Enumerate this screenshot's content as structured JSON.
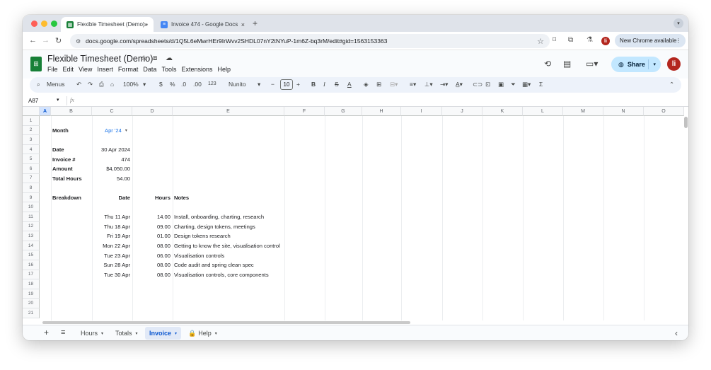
{
  "browser": {
    "tabs": [
      {
        "title": "Flexible Timesheet (Demo) - ",
        "close": "×"
      },
      {
        "title": "Invoice 474 - Google Docs",
        "close": "×"
      }
    ],
    "new_tab": "+",
    "url": "docs.google.com/spreadsheets/d/1Q5L6eMwrHEr9IrWvv2SHDL07nY2tNYuP-1m6Z-bq3rM/edit#gid=1563153363",
    "profile_initial": "li",
    "update_pill": "New Chrome available",
    "update_pill_more": "⋮"
  },
  "docs": {
    "title": "Flexible Timesheet (Demo)",
    "menu": [
      "File",
      "Edit",
      "View",
      "Insert",
      "Format",
      "Data",
      "Tools",
      "Extensions",
      "Help"
    ],
    "share_label": "Share",
    "avatar_initial": "li"
  },
  "toolbar": {
    "search": "Menus",
    "zoom": "100%",
    "currency": "$",
    "percent": "%",
    "dec_less": ".0",
    "dec_more": ".00",
    "num_format": "123",
    "font": "Nunito",
    "font_size": "10",
    "minus": "−",
    "plus": "+",
    "bold": "B",
    "italic": "I",
    "strike": "S",
    "text_color": "A",
    "sigma": "Σ"
  },
  "formula_bar": {
    "cell_ref": "A87",
    "fx": "fx",
    "value": ""
  },
  "columns": [
    "A",
    "B",
    "C",
    "D",
    "E",
    "F",
    "G",
    "H",
    "I",
    "J",
    "K",
    "L",
    "M",
    "N",
    "O"
  ],
  "rows": [
    "1",
    "2",
    "3",
    "4",
    "5",
    "6",
    "7",
    "8",
    "9",
    "10",
    "11",
    "12",
    "13",
    "14",
    "15",
    "16",
    "17",
    "18",
    "19",
    "20",
    "21"
  ],
  "sheet": {
    "month_label": "Month",
    "month_value": "Apr '24",
    "date_label": "Date",
    "date_value": "30 Apr 2024",
    "invoice_label": "Invoice #",
    "invoice_value": "474",
    "amount_label": "Amount",
    "amount_value": "$4,050.00",
    "hours_label": "Total Hours",
    "hours_value": "54.00",
    "breakdown_label": "Breakdown",
    "col_date": "Date",
    "col_hours": "Hours",
    "col_notes": "Notes",
    "entries": [
      {
        "date": "Thu 11 Apr",
        "hours": "14.00",
        "notes": "Install, onboarding, charting, research"
      },
      {
        "date": "Thu 18 Apr",
        "hours": "09.00",
        "notes": "Charting, design tokens, meetings"
      },
      {
        "date": "Fri 19 Apr",
        "hours": "01.00",
        "notes": "Design tokens research"
      },
      {
        "date": "Mon 22 Apr",
        "hours": "08.00",
        "notes": "Getting to know the site, visualisation control"
      },
      {
        "date": "Tue 23 Apr",
        "hours": "06.00",
        "notes": "Visualisation controls"
      },
      {
        "date": "Sun 28 Apr",
        "hours": "08.00",
        "notes": "Code audit and spring clean spec"
      },
      {
        "date": "Tue 30 Apr",
        "hours": "08.00",
        "notes": "Visualisation controls, core components"
      }
    ]
  },
  "sheet_tabs": {
    "add": "+",
    "list": "≡",
    "tabs": [
      {
        "label": "Hours"
      },
      {
        "label": "Totals"
      },
      {
        "label": "Invoice"
      },
      {
        "label": "Help"
      }
    ],
    "collapse": "‹"
  },
  "colors": {
    "sheets_green": "#188038",
    "share_blue": "#c2e7ff",
    "link_blue": "#1a73e8",
    "active_tab": "#0b57d0"
  }
}
